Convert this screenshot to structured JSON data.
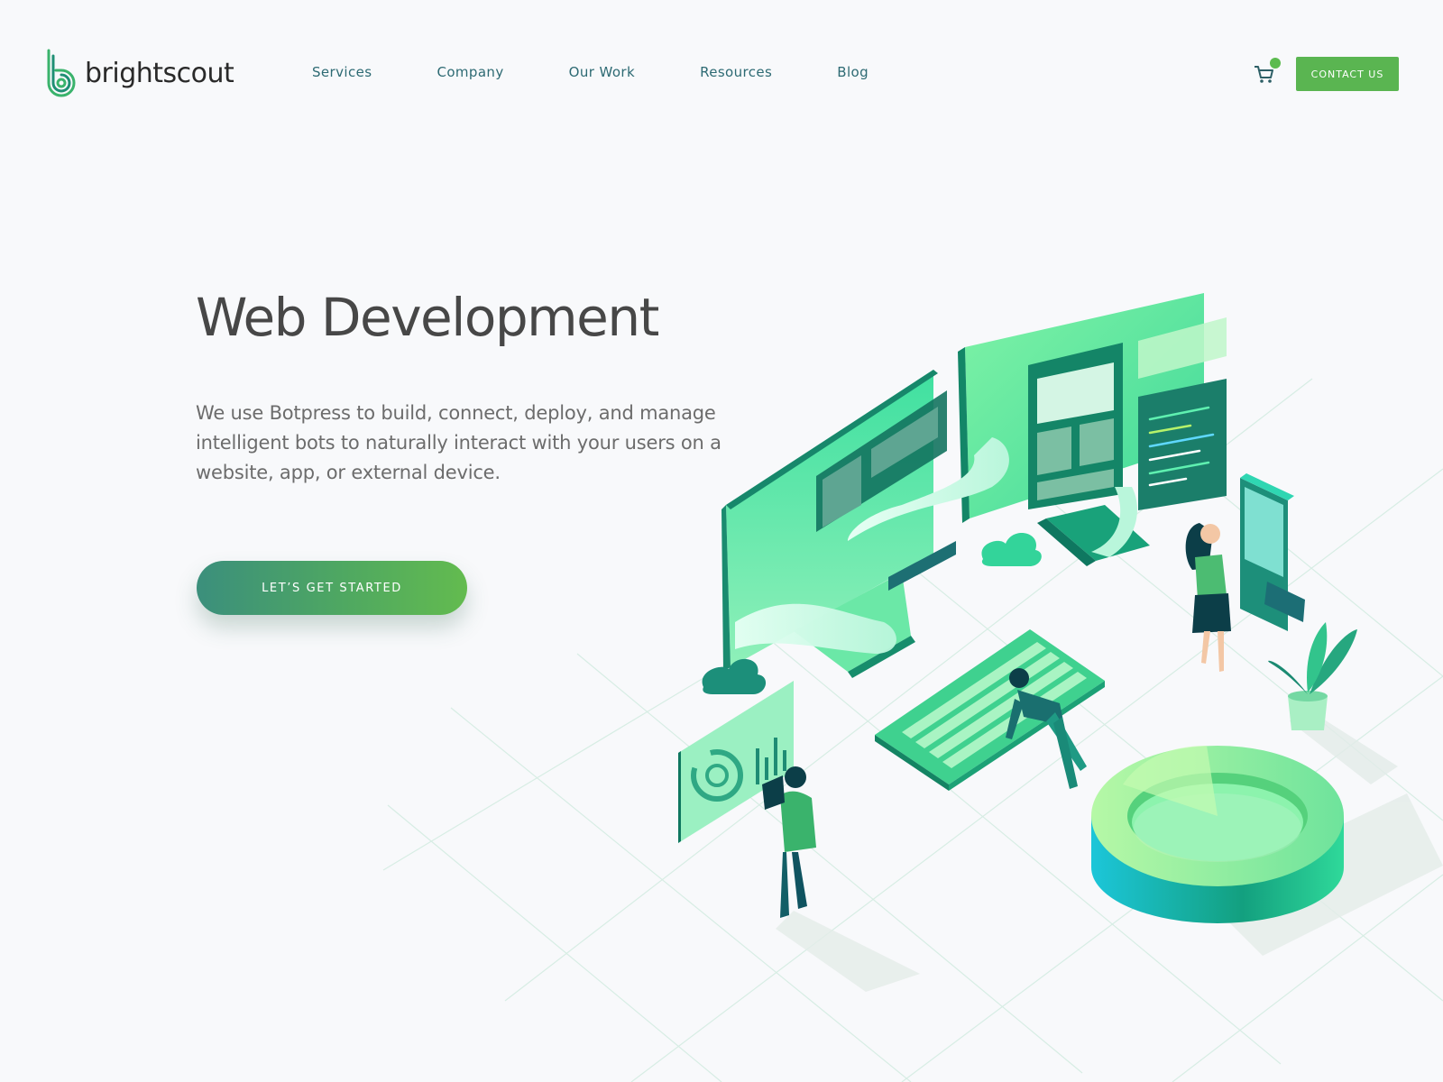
{
  "brand": {
    "name": "brightscout",
    "logo_icon": "brightscout-logo-icon"
  },
  "nav": {
    "items": [
      {
        "label": "Services"
      },
      {
        "label": "Company"
      },
      {
        "label": "Our Work"
      },
      {
        "label": "Resources"
      },
      {
        "label": "Blog"
      }
    ]
  },
  "header": {
    "cart_icon": "cart-icon",
    "contact_label": "CONTACT US"
  },
  "hero": {
    "title": "Web Development",
    "description": "We use Botpress to build, connect, deploy, and manage intelligent bots to naturally interact with your users on a website, app, or external device.",
    "cta_label": "LET’S GET STARTED"
  },
  "colors": {
    "accent_green": "#5ab551",
    "nav_teal": "#2d6a73",
    "title_gray": "#474747"
  }
}
